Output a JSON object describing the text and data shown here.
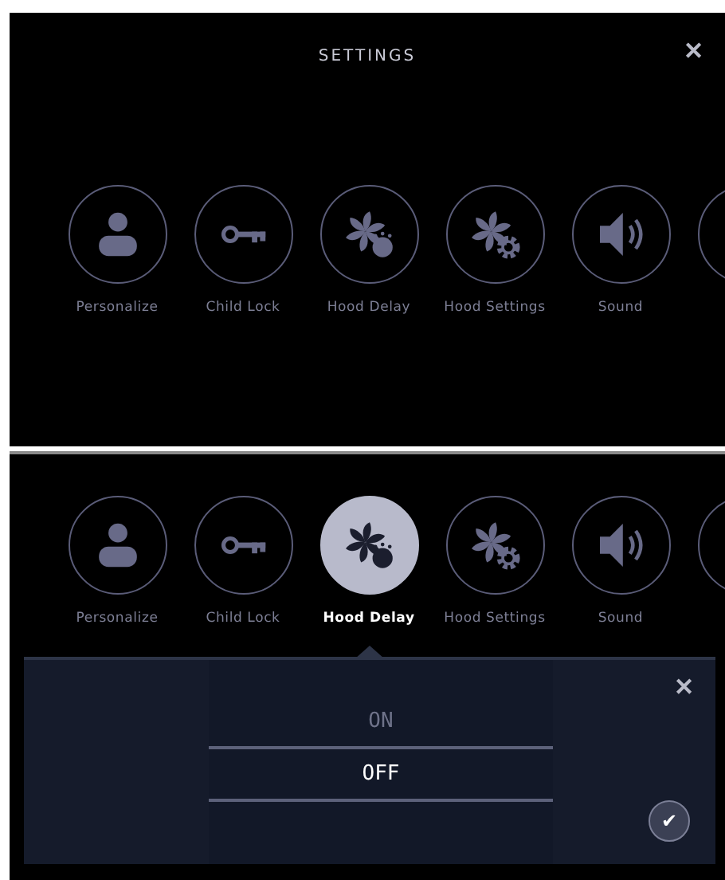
{
  "screens": [
    {
      "title": "SETTINGS",
      "close": "✕",
      "items": [
        {
          "kind": "person",
          "label": "Personalize",
          "selected": false
        },
        {
          "kind": "key",
          "label": "Child Lock",
          "selected": false
        },
        {
          "kind": "fan-timer",
          "label": "Hood Delay",
          "selected": false
        },
        {
          "kind": "fan-gear",
          "label": "Hood Settings",
          "selected": false
        },
        {
          "kind": "speaker",
          "label": "Sound",
          "selected": false
        },
        {
          "kind": "clipped",
          "selected": false
        }
      ]
    },
    {
      "items": [
        {
          "kind": "person",
          "label": "Personalize",
          "selected": false
        },
        {
          "kind": "key",
          "label": "Child Lock",
          "selected": false
        },
        {
          "kind": "fan-timer",
          "label": "Hood Delay",
          "selected": true
        },
        {
          "kind": "fan-gear",
          "label": "Hood Settings",
          "selected": false
        },
        {
          "kind": "speaker",
          "label": "Sound",
          "selected": false
        },
        {
          "kind": "clipped",
          "selected": false
        }
      ],
      "popup": {
        "close": "✕",
        "options": [
          {
            "label": "ON",
            "selected": false
          },
          {
            "label": "OFF",
            "selected": true
          }
        ],
        "confirm": "✔"
      }
    }
  ]
}
